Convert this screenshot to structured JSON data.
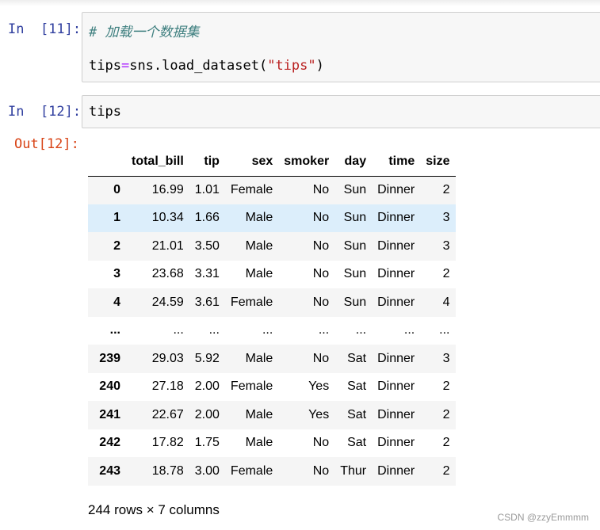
{
  "cells": [
    {
      "prompt": "In  [11]:",
      "comment": "# 加载一个数据集",
      "code": {
        "var": "tips",
        "op": "=",
        "call": "sns.load_dataset(",
        "arg": "\"tips\"",
        "close": ")"
      }
    },
    {
      "prompt": "In  [12]:",
      "code": "tips"
    }
  ],
  "output": {
    "prompt": "Out[12]:",
    "columns": [
      "",
      "total_bill",
      "tip",
      "sex",
      "smoker",
      "day",
      "time",
      "size"
    ],
    "rows": [
      [
        "0",
        "16.99",
        "1.01",
        "Female",
        "No",
        "Sun",
        "Dinner",
        "2"
      ],
      [
        "1",
        "10.34",
        "1.66",
        "Male",
        "No",
        "Sun",
        "Dinner",
        "3"
      ],
      [
        "2",
        "21.01",
        "3.50",
        "Male",
        "No",
        "Sun",
        "Dinner",
        "3"
      ],
      [
        "3",
        "23.68",
        "3.31",
        "Male",
        "No",
        "Sun",
        "Dinner",
        "2"
      ],
      [
        "4",
        "24.59",
        "3.61",
        "Female",
        "No",
        "Sun",
        "Dinner",
        "4"
      ],
      [
        "...",
        "...",
        "...",
        "...",
        "...",
        "...",
        "...",
        "..."
      ],
      [
        "239",
        "29.03",
        "5.92",
        "Male",
        "No",
        "Sat",
        "Dinner",
        "3"
      ],
      [
        "240",
        "27.18",
        "2.00",
        "Female",
        "Yes",
        "Sat",
        "Dinner",
        "2"
      ],
      [
        "241",
        "22.67",
        "2.00",
        "Male",
        "Yes",
        "Sat",
        "Dinner",
        "2"
      ],
      [
        "242",
        "17.82",
        "1.75",
        "Male",
        "No",
        "Sat",
        "Dinner",
        "2"
      ],
      [
        "243",
        "18.78",
        "3.00",
        "Female",
        "No",
        "Thur",
        "Dinner",
        "2"
      ]
    ],
    "shape": "244 rows × 7 columns"
  },
  "watermark": "CSDN @zzyEmmmm",
  "colors": {
    "prompt_in": "#303f9f",
    "prompt_out": "#d84315",
    "cell_bg": "#f7f7f7",
    "row_stripe": "#f5f5f5",
    "row_hover": "#dceefb"
  }
}
